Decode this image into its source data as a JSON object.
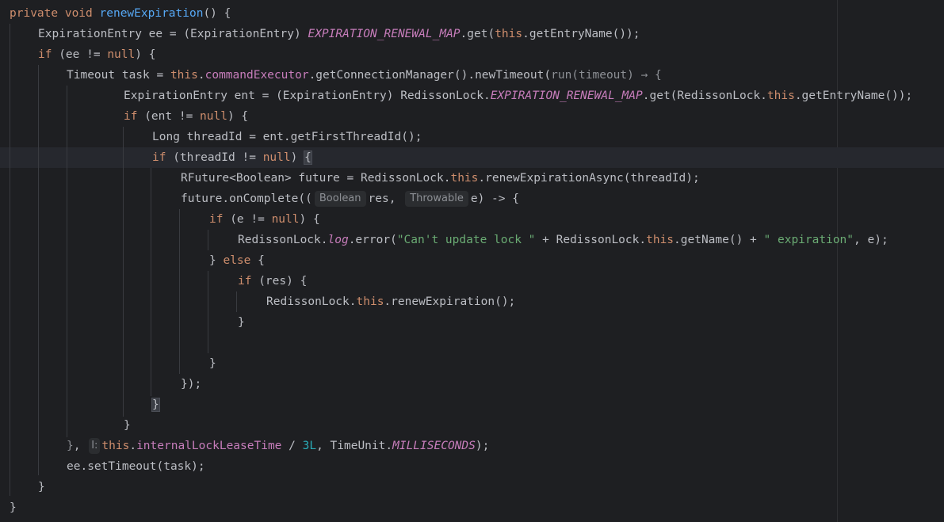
{
  "editor": {
    "language": "java",
    "colors": {
      "background": "#1e1f22",
      "text": "#bcbec4",
      "keyword": "#cf8e6d",
      "method_decl": "#56a8f5",
      "static_field": "#c77dbb",
      "string": "#6aab73",
      "number": "#2aacb8",
      "hint": "#8c8f94"
    },
    "icons": [
      "inlay-param-icon"
    ],
    "tokens": {
      "t0": "private",
      "t1": " ",
      "t2": "void",
      "t3": " ",
      "t4": "renewExpiration",
      "t5": "() {",
      "t6": "ExpirationEntry ee = (ExpirationEntry) ",
      "t7": "EXPIRATION_RENEWAL_MAP",
      "t8": ".get(",
      "t9": "this",
      "t10": ".getEntryName());",
      "t11": "if",
      "t12": " (ee != ",
      "t13": "null",
      "t14": ") {",
      "t15": "Timeout task = ",
      "t16": "this",
      "t17": ".",
      "t18": "commandExecutor",
      "t19": ".getConnectionManager().newTimeout(",
      "t20": "run(timeout) → {",
      "t21": "ExpirationEntry ent = (ExpirationEntry) RedissonLock.",
      "t22": "EXPIRATION_RENEWAL_MAP",
      "t23": ".get(RedissonLock.",
      "t24": "this",
      "t25": ".getEntryName());",
      "t26": "if",
      "t27": " (ent != ",
      "t28": "null",
      "t29": ") {",
      "t30": "Long threadId = ent.getFirstThreadId();",
      "t31": "if",
      "t32": " (threadId != ",
      "t33": "null",
      "t34": ") ",
      "t35": "{",
      "t36": "RFuture<Boolean> future = RedissonLock.",
      "t37": "this",
      "t38": ".renewExpirationAsync(threadId);",
      "t39": "future.onComplete((",
      "t40": "Boolean",
      "t41": "res, ",
      "t42": "Throwable",
      "t43": "e) -> {",
      "t44": "if",
      "t45": " (e != ",
      "t46": "null",
      "t47": ") {",
      "t48": "RedissonLock.",
      "t49": "log",
      "t50": ".error(",
      "t51": "\"Can't update lock \"",
      "t52": " + RedissonLock.",
      "t53": "this",
      "t54": ".getName() + ",
      "t55": "\" expiration\"",
      "t56": ", e);",
      "t57": "} ",
      "t58": "else",
      "t59": " {",
      "t60": "if",
      "t61": " (res) {",
      "t62": "RedissonLock.",
      "t63": "this",
      "t64": ".renewExpiration();",
      "t65": "}",
      "t66": "}",
      "t67": "});",
      "t68": "}",
      "t69": "}",
      "t70": "}",
      "t71": ", ",
      "t72": "I:",
      "t73": "this",
      "t74": ".",
      "t75": "internalLockLeaseTime",
      "t76": " / ",
      "t77": "3L",
      "t78": ", TimeUnit.",
      "t79": "MILLISECONDS",
      "t80": ");",
      "t81": "ee.setTimeout(task);",
      "t82": "}",
      "t83": "}"
    }
  }
}
